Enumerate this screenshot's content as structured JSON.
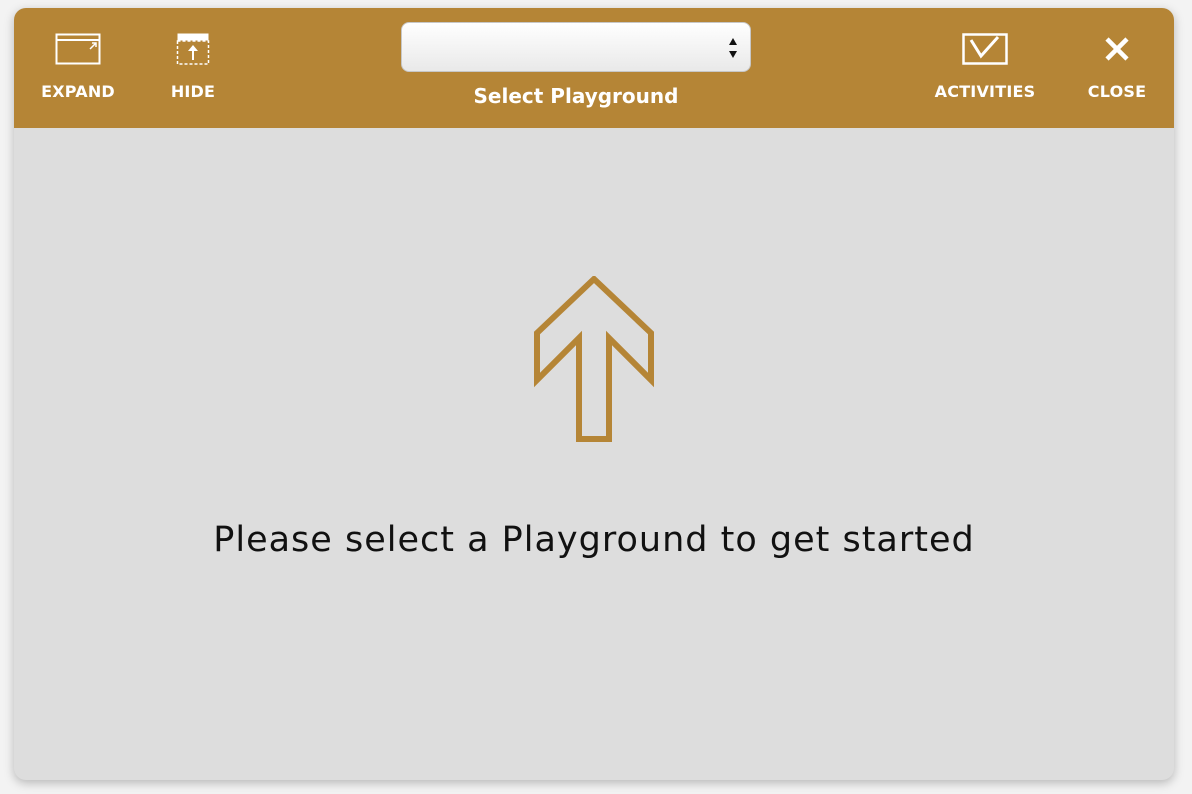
{
  "toolbar": {
    "expand_label": "EXPAND",
    "hide_label": "HIDE",
    "activities_label": "ACTIVITIES",
    "close_label": "CLOSE",
    "playground_select": {
      "value": "",
      "caption": "Select Playground"
    }
  },
  "main": {
    "prompt": "Please select a Playground to get started",
    "arrow_icon": "up-arrow-outline-icon"
  },
  "colors": {
    "toolbar_bg": "#b58536",
    "content_bg": "#dddddd",
    "accent": "#b58536",
    "text": "#111111"
  }
}
